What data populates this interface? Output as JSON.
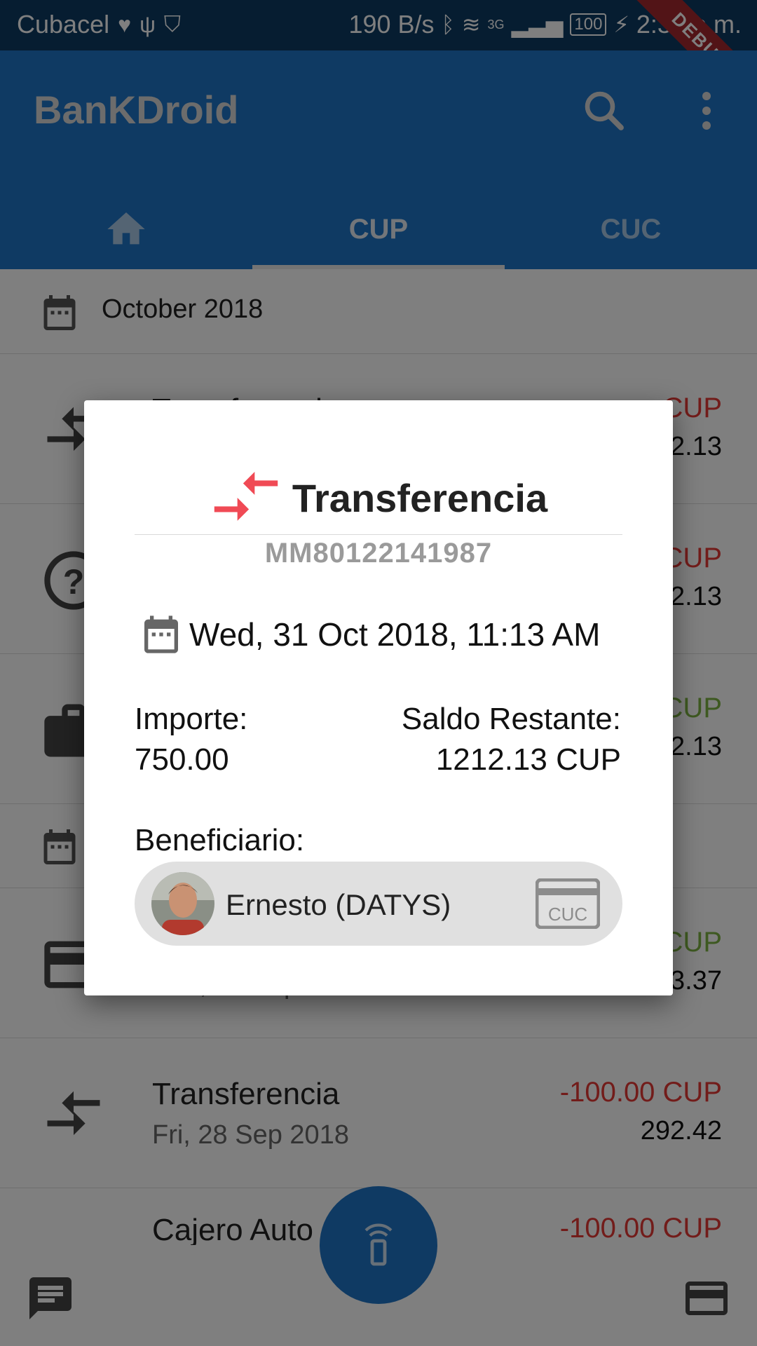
{
  "status_bar": {
    "carrier": "Cubacel",
    "net_speed": "190 B/s",
    "network_type": "3G",
    "battery": "100",
    "time": "2:32 p.m.",
    "debug_banner": "DEBUG"
  },
  "app_bar": {
    "title": "BanKDroid",
    "search_icon": "search-icon",
    "menu_icon": "more-vert-icon"
  },
  "tabs": [
    {
      "label": "",
      "icon": "home-icon",
      "selected": false
    },
    {
      "label": "CUP",
      "selected": true
    },
    {
      "label": "CUC",
      "selected": false
    }
  ],
  "list": {
    "month_1": "October 2018",
    "rows": [
      {
        "title": "Transferencia",
        "amount": "CUP",
        "balance": "2.13",
        "amount_color": "#e53935",
        "icon": "transfer-icon"
      },
      {
        "title": "",
        "amount": "CUP",
        "balance": "2.13",
        "amount_color": "#e53935",
        "icon": "help-icon"
      },
      {
        "title": "",
        "amount": "CUP",
        "balance": "2.13",
        "amount_color": "#7cb342",
        "icon": "briefcase-icon"
      },
      {
        "title": "",
        "subtitle": "Sun, 30 Sep 2018",
        "amount": "CUP",
        "balance": "3.37",
        "amount_color": "#7cb342",
        "icon": "credit-card-icon"
      },
      {
        "title": "Transferencia",
        "subtitle": "Fri, 28 Sep 2018",
        "amount": "-100.00 CUP",
        "balance": "292.42",
        "amount_color": "#e53935",
        "icon": "transfer-icon"
      },
      {
        "title": "Cajero Auto",
        "amount": "-100.00 CUP",
        "icon": "atm-icon"
      }
    ]
  },
  "dialog": {
    "title": "Transferencia",
    "reference": "MM80122141987",
    "date": "Wed, 31 Oct 2018, 11:13 AM",
    "importe_label": "Importe:",
    "importe_value": "750.00",
    "saldo_label": "Saldo Restante:",
    "saldo_value": "1212.13 CUP",
    "beneficiario_label": "Beneficiario:",
    "beneficiary_name": "Ernesto (DATYS)",
    "beneficiary_card": "CUC"
  },
  "colors": {
    "primary": "#1f75c6",
    "status_bar": "#0c3a63",
    "debit": "#e53935",
    "credit": "#7cb342",
    "transfer_icon": "#f04a55"
  }
}
